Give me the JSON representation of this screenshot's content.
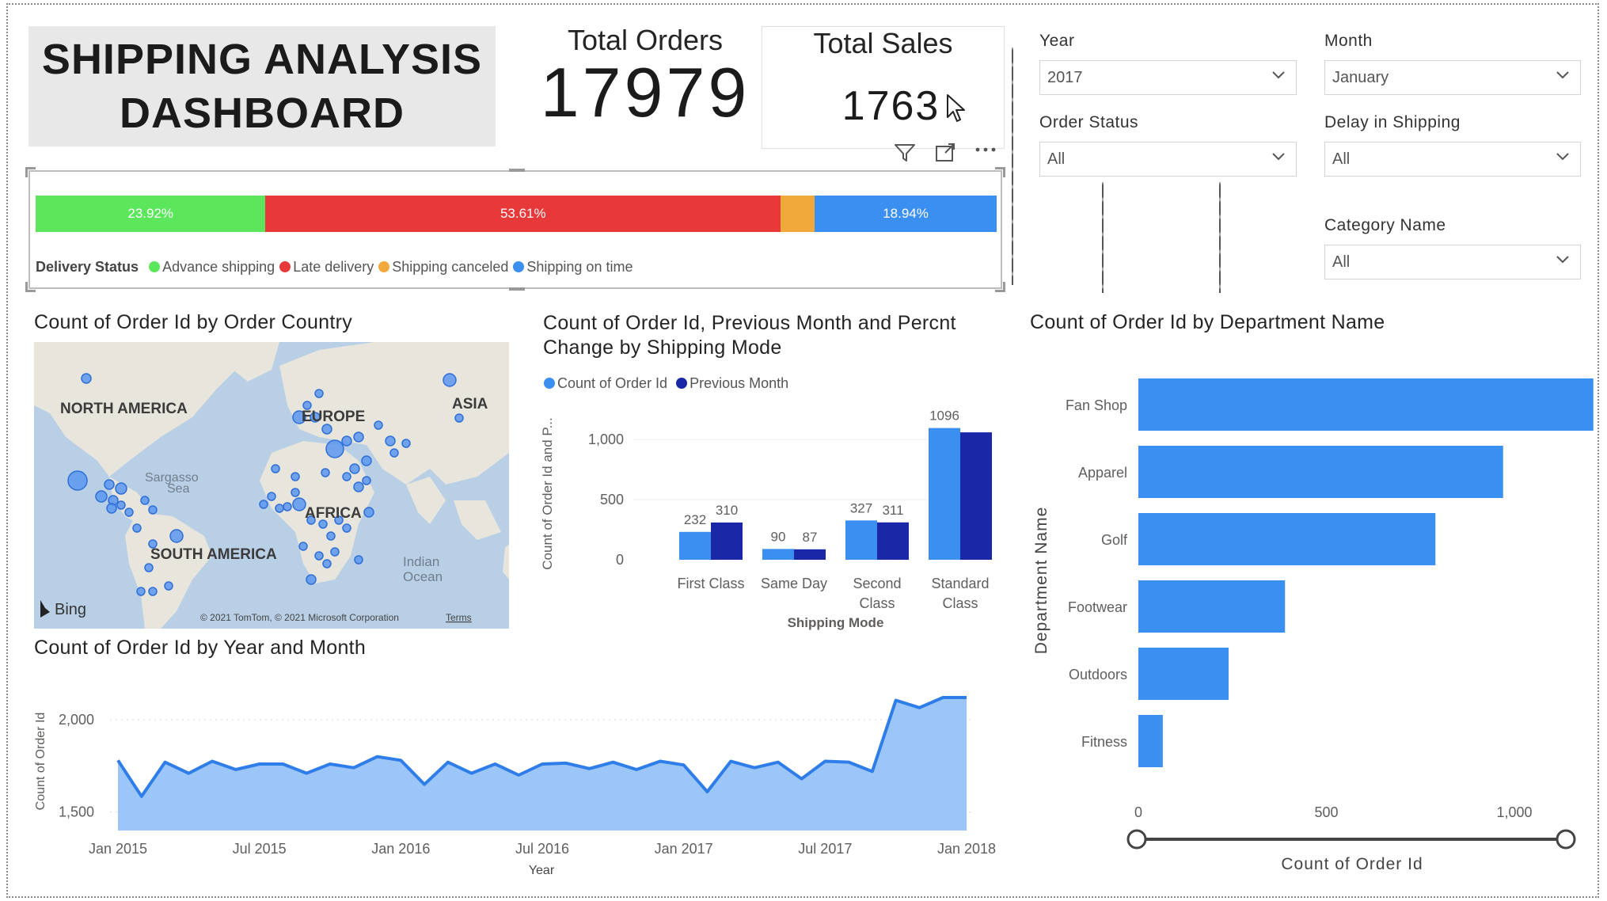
{
  "header": {
    "title_line1": "SHIPPING ANALYSIS",
    "title_line2": "DASHBOARD"
  },
  "kpis": {
    "total_orders_label": "Total Orders",
    "total_orders_value": "17979",
    "total_sales_label": "Total Sales",
    "total_sales_value": "1763"
  },
  "slicers": {
    "year": {
      "label": "Year",
      "value": "2017"
    },
    "month": {
      "label": "Month",
      "value": "January"
    },
    "order_status": {
      "label": "Order Status",
      "value": "All"
    },
    "delay_in_shipping": {
      "label": "Delay in Shipping",
      "value": "All"
    },
    "category_name": {
      "label": "Category Name",
      "value": "All"
    }
  },
  "delivery_status": {
    "legend_title": "Delivery Status",
    "segments": [
      {
        "name": "Advance shipping",
        "percent": 23.92,
        "label": "23.92%",
        "color": "#5ce65c"
      },
      {
        "name": "Late delivery",
        "percent": 53.61,
        "label": "53.61%",
        "color": "#e8393a"
      },
      {
        "name": "Shipping canceled",
        "percent": 3.53,
        "label": "",
        "color": "#f2a93b"
      },
      {
        "name": "Shipping on time",
        "percent": 18.94,
        "label": "18.94%",
        "color": "#3a8ff0"
      }
    ]
  },
  "map": {
    "title": "Count of Order Id by Order Country",
    "labels": {
      "north_america": "NORTH AMERICA",
      "europe": "EUROPE",
      "asia": "ASIA",
      "africa": "AFRICA",
      "south_america": "SOUTH AMERICA",
      "sargasso_1": "Sargasso",
      "sargasso_2": "Sea",
      "indian_1": "Indian",
      "indian_2": "Ocean"
    },
    "bing": "Bing",
    "copyright": "© 2021 TomTom, © 2021 Microsoft Corporation",
    "terms": "Terms"
  },
  "shipping_mode_chart": {
    "title_line1": "Count of Order Id, Previous Month and Percnt",
    "title_line2": "Change by Shipping Mode",
    "legend": [
      "Count of Order Id",
      "Previous Month"
    ],
    "colors": [
      "#3a8ff0",
      "#1a28a8"
    ],
    "ylabel": "Count of Order Id and P...",
    "xlabel": "Shipping Mode",
    "yticks": [
      "0",
      "500",
      "1,000"
    ]
  },
  "department_chart": {
    "title": "Count of Order Id by Department Name",
    "ylabel": "Department Name",
    "xlabel": "Count of Order Id",
    "xticks": [
      "0",
      "500",
      "1,000"
    ]
  },
  "year_month_chart": {
    "title": "Count of Order Id by Year and Month",
    "ylabel": "Count of Order Id",
    "xlabel": "Year",
    "yticks": [
      "1,500",
      "2,000"
    ],
    "xticks": [
      "Jan 2015",
      "Jul 2015",
      "Jan 2016",
      "Jul 2016",
      "Jan 2017",
      "Jul 2017",
      "Jan 2018"
    ]
  },
  "chart_data": [
    {
      "type": "bar",
      "title": "Count of Order Id, Previous Month and Percnt Change by Shipping Mode",
      "categories": [
        "First Class",
        "Same Day",
        "Second Class",
        "Standard Class"
      ],
      "series": [
        {
          "name": "Count of Order Id",
          "values": [
            232,
            90,
            327,
            1096
          ]
        },
        {
          "name": "Previous Month",
          "values": [
            310,
            87,
            311,
            1060
          ]
        }
      ],
      "xlabel": "Shipping Mode",
      "ylabel": "Count of Order Id and P...",
      "ylim": [
        0,
        1100
      ],
      "legend": "top-left"
    },
    {
      "type": "bar",
      "orientation": "horizontal",
      "title": "Count of Order Id by Department Name",
      "categories": [
        "Fan Shop",
        "Apparel",
        "Golf",
        "Footwear",
        "Outdoors",
        "Fitness"
      ],
      "values": [
        1210,
        970,
        790,
        390,
        240,
        65
      ],
      "xlabel": "Count of Order Id",
      "ylabel": "Department Name",
      "xlim": [
        0,
        1400
      ]
    },
    {
      "type": "area",
      "title": "Count of Order Id by Year and Month",
      "x": [
        "2015-01",
        "2015-02",
        "2015-03",
        "2015-04",
        "2015-05",
        "2015-06",
        "2015-07",
        "2015-08",
        "2015-09",
        "2015-10",
        "2015-11",
        "2015-12",
        "2016-01",
        "2016-02",
        "2016-03",
        "2016-04",
        "2016-05",
        "2016-06",
        "2016-07",
        "2016-08",
        "2016-09",
        "2016-10",
        "2016-11",
        "2016-12",
        "2017-01",
        "2017-02",
        "2017-03",
        "2017-04",
        "2017-05",
        "2017-06",
        "2017-07",
        "2017-08",
        "2017-09",
        "2017-10",
        "2017-11",
        "2017-12",
        "2018-01"
      ],
      "values": [
        1780,
        1585,
        1770,
        1710,
        1775,
        1730,
        1760,
        1760,
        1710,
        1760,
        1740,
        1800,
        1780,
        1650,
        1770,
        1710,
        1760,
        1700,
        1760,
        1765,
        1735,
        1770,
        1730,
        1775,
        1755,
        1610,
        1775,
        1740,
        1770,
        1680,
        1775,
        1770,
        1720,
        2105,
        2065,
        2120,
        2120
      ],
      "xlabel": "Year",
      "ylabel": "Count of Order Id",
      "ylim": [
        1400,
        2150
      ]
    }
  ]
}
